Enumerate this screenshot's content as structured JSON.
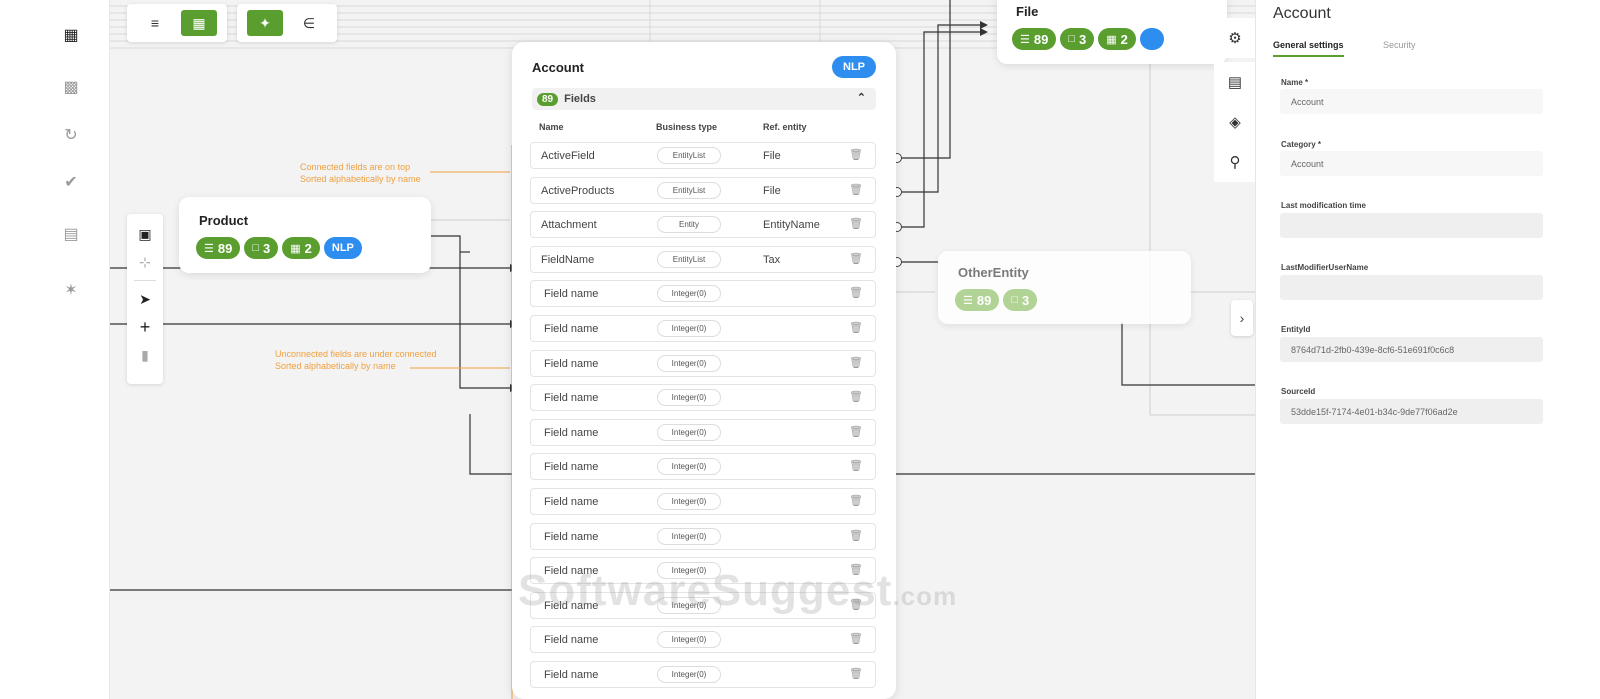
{
  "sidebar": {
    "items": [
      {
        "icon": "document-icon"
      },
      {
        "icon": "book-icon"
      },
      {
        "icon": "sync-icon"
      },
      {
        "icon": "check-circle-icon"
      },
      {
        "icon": "storage-icon"
      },
      {
        "icon": "puzzle-icon"
      }
    ]
  },
  "toolbar": {
    "group1": [
      "align-left-icon",
      "hierarchy-icon"
    ],
    "group2": [
      "network-icon",
      "tree-layout-icon"
    ]
  },
  "vertical_tools": [
    "fit-screen-icon",
    "fit-selection-icon",
    "pointer-icon",
    "add-icon",
    "delete-icon"
  ],
  "product_node": {
    "title": "Product",
    "fields_count": "89",
    "comments_count": "3",
    "grid_count": "2",
    "nlp_label": "NLP"
  },
  "file_node": {
    "title": "File",
    "fields_count": "89",
    "comments_count": "3",
    "grid_count": "2"
  },
  "other_node": {
    "title": "OtherEntity",
    "fields_count": "89",
    "comments_count": "3"
  },
  "annotations": {
    "connected_line1": "Connected fields are on top",
    "connected_line2": "Sorted alphabetically by name",
    "unconnected_line1": "Unconnected fields are under connected",
    "unconnected_line2": "Sorted alphabetically by name"
  },
  "account_node": {
    "title": "Account",
    "nlp_label": "NLP",
    "fields_count": "89",
    "fields_label": "Fields",
    "col_name": "Name",
    "col_business": "Business type",
    "col_ref": "Ref. entity",
    "rows": [
      {
        "name": "ActiveField",
        "type": "EntityList",
        "ref": "File",
        "connected": true
      },
      {
        "name": "ActiveProducts",
        "type": "EntityList",
        "ref": "File",
        "connected": true
      },
      {
        "name": "Attachment",
        "type": "Entity",
        "ref": "EntityName",
        "connected": true
      },
      {
        "name": "FieldName",
        "type": "EntityList",
        "ref": "Tax",
        "connected": true
      },
      {
        "name": "Field name",
        "type": "Integer(0)",
        "ref": "",
        "connected": false
      },
      {
        "name": "Field name",
        "type": "Integer(0)",
        "ref": "",
        "connected": false
      },
      {
        "name": "Field name",
        "type": "Integer(0)",
        "ref": "",
        "connected": false
      },
      {
        "name": "Field name",
        "type": "Integer(0)",
        "ref": "",
        "connected": false
      },
      {
        "name": "Field name",
        "type": "Integer(0)",
        "ref": "",
        "connected": false
      },
      {
        "name": "Field name",
        "type": "Integer(0)",
        "ref": "",
        "connected": false
      },
      {
        "name": "Field name",
        "type": "Integer(0)",
        "ref": "",
        "connected": false
      },
      {
        "name": "Field name",
        "type": "Integer(0)",
        "ref": "",
        "connected": false
      },
      {
        "name": "Field name",
        "type": "Integer(0)",
        "ref": "",
        "connected": false
      },
      {
        "name": "Field name",
        "type": "Integer(0)",
        "ref": "",
        "connected": false
      },
      {
        "name": "Field name",
        "type": "Integer(0)",
        "ref": "",
        "connected": false
      },
      {
        "name": "Field name",
        "type": "Integer(0)",
        "ref": "",
        "connected": false
      }
    ]
  },
  "right_icons": [
    "settings-icon",
    "comment-icon",
    "layers-icon",
    "search-icon"
  ],
  "panel": {
    "title": "Account",
    "tab_general": "General settings",
    "tab_security": "Security",
    "name_label": "Name *",
    "name_value": "Account",
    "category_label": "Category *",
    "category_value": "Account",
    "lastmod_label": "Last modification time",
    "lastmod_value": "",
    "lastmoduser_label": "LastModifierUserName",
    "lastmoduser_value": "",
    "entityid_label": "EntityId",
    "entityid_value": "8764d71d-2fb0-439e-8cf6-51e691f0c6c8",
    "sourceid_label": "SourceId",
    "sourceid_value": "53dde15f-7174-4e01-b34c-9de77f06ad2e"
  },
  "watermark": {
    "main": "SoftwareSuggest",
    "suffix": ".com"
  },
  "colors": {
    "green": "#5a9e2f",
    "blue": "#2d8ef0",
    "annotation": "#f0a040"
  }
}
